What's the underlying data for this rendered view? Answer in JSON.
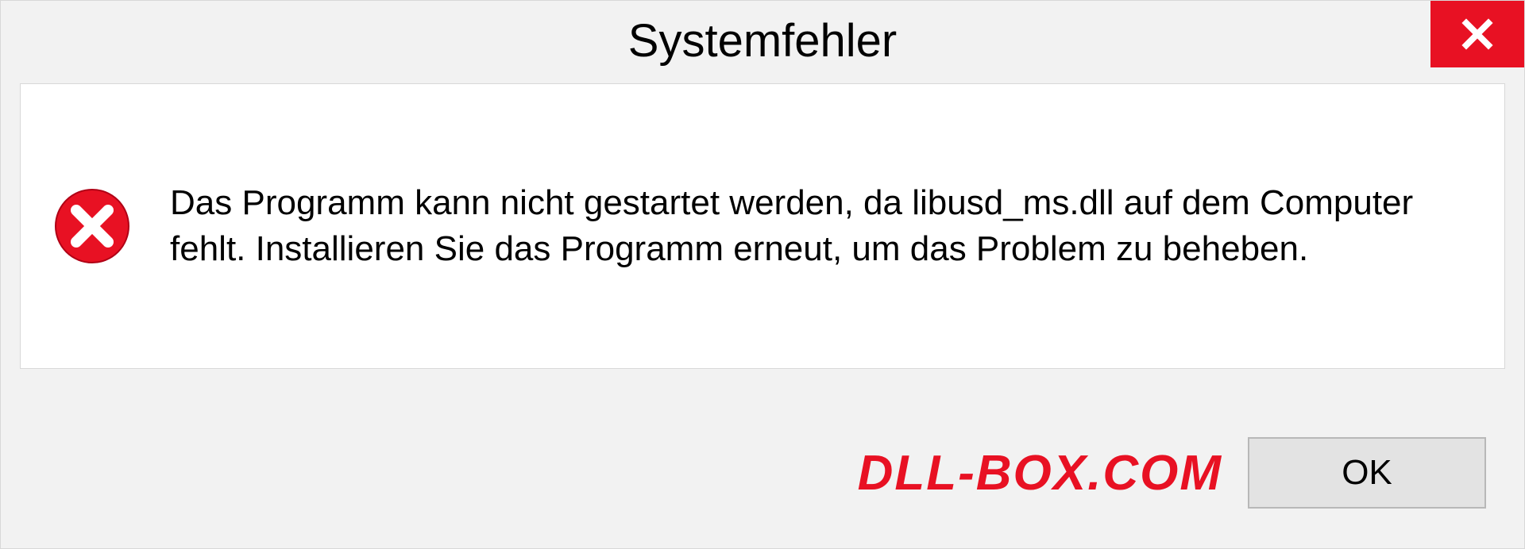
{
  "dialog": {
    "title": "Systemfehler",
    "message": "Das Programm kann nicht gestartet werden, da libusd_ms.dll auf dem Computer fehlt. Installieren Sie das Programm erneut, um das Problem zu beheben.",
    "ok_label": "OK"
  },
  "watermark": "DLL-BOX.COM",
  "colors": {
    "error_red": "#e81123",
    "panel_bg": "#ffffff",
    "dialog_bg": "#f2f2f2"
  }
}
